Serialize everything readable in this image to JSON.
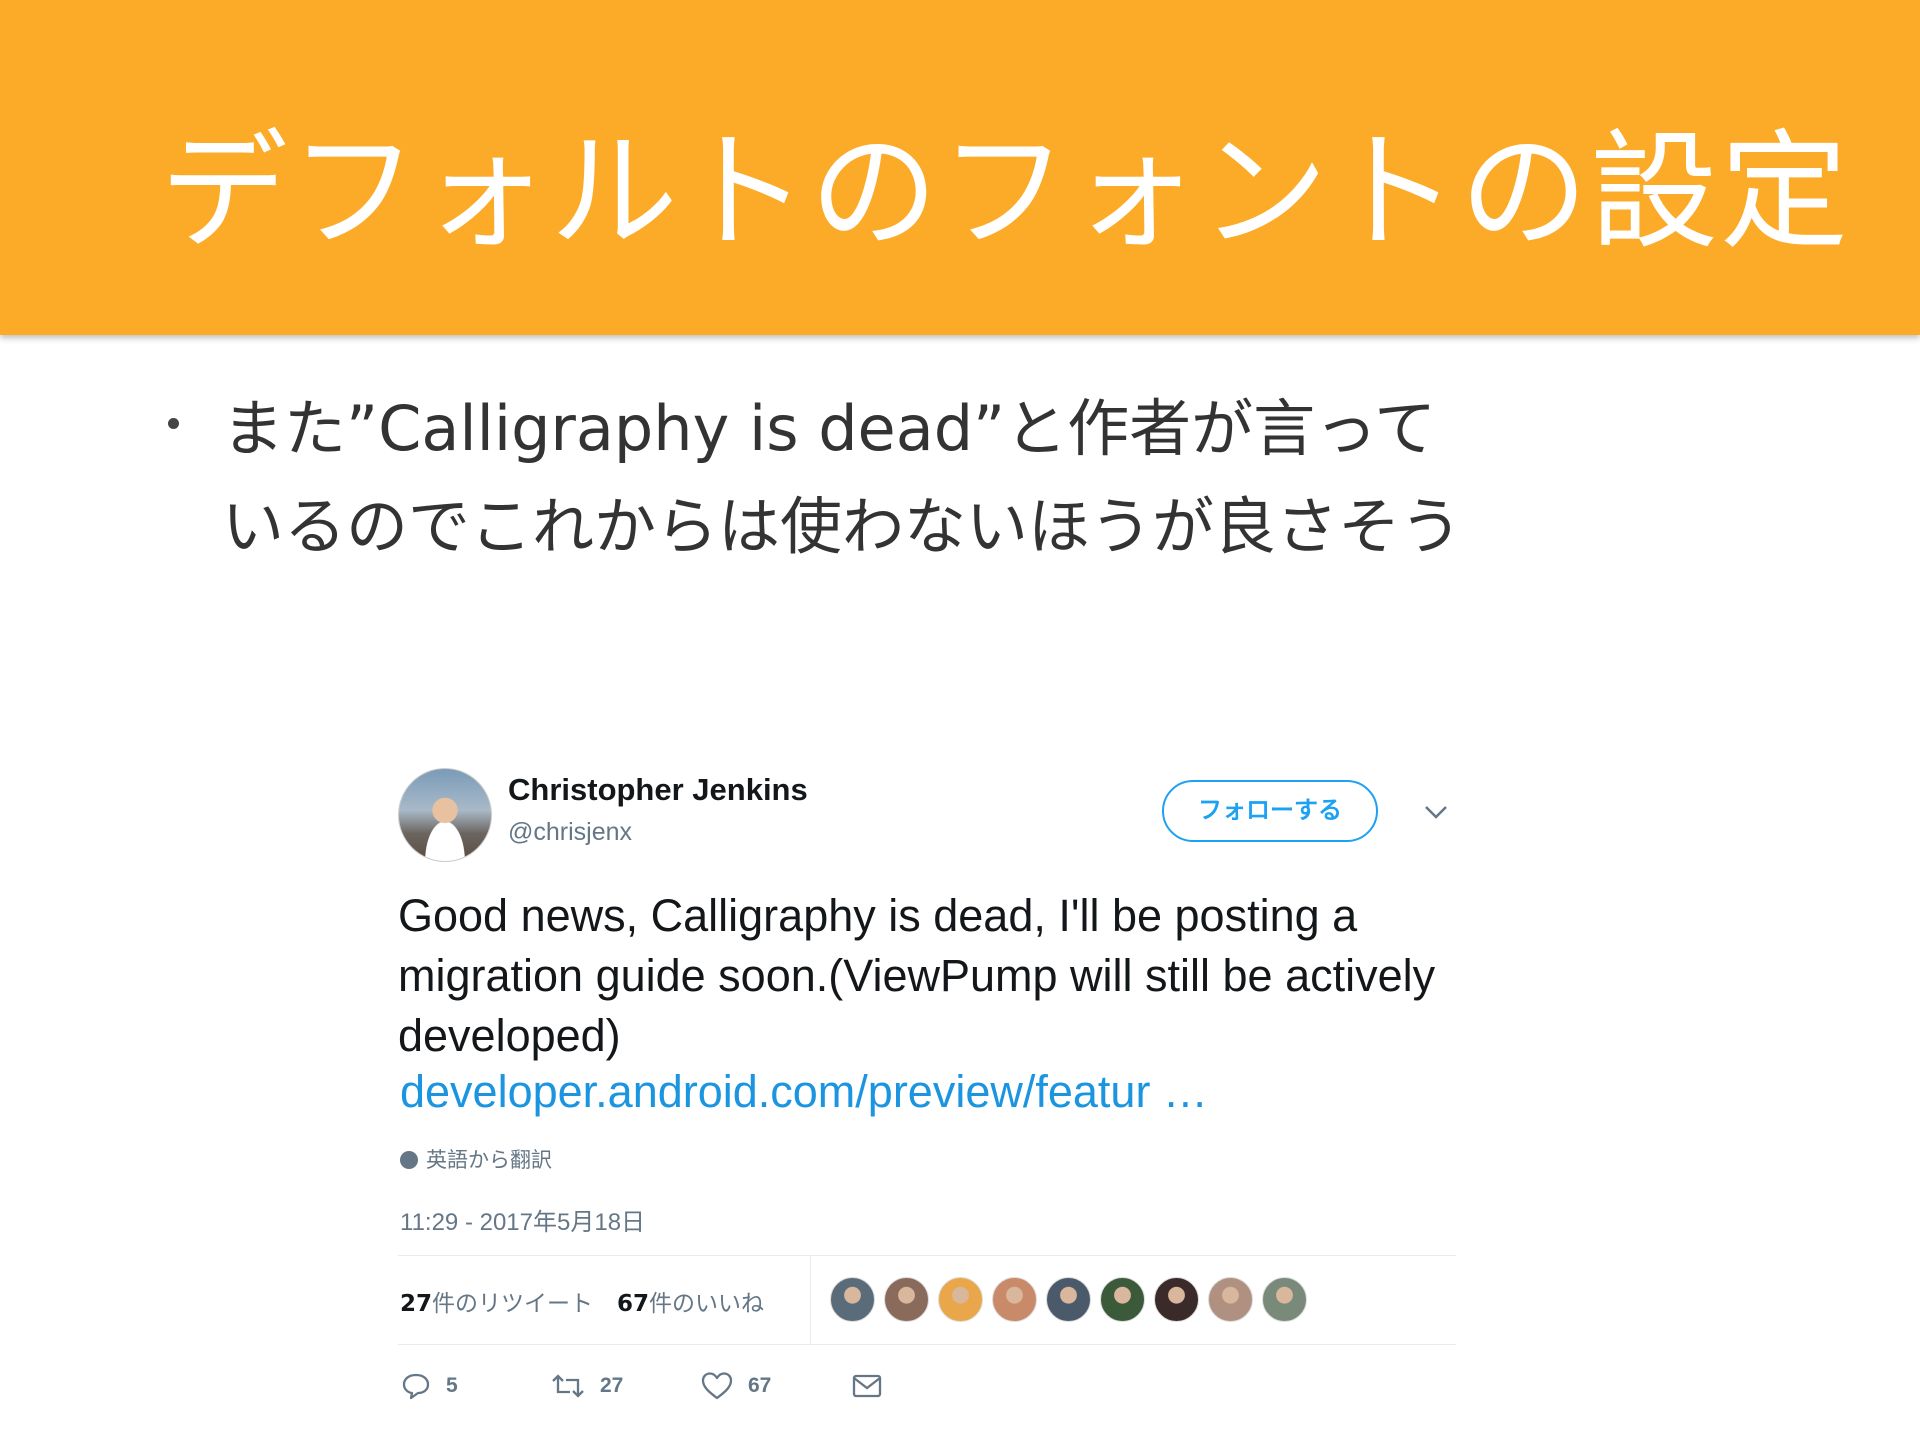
{
  "slide": {
    "title": "デフォルトのフォントの設定",
    "bullet_line1": "また”Calligraphy is dead”と作者が言って",
    "bullet_line2": "いるのでこれからは使わないほうが良さそう"
  },
  "tweet": {
    "author_name": "Christopher Jenkins",
    "author_handle": "@chrisjenx",
    "follow_label": "フォローする",
    "text": "Good news, Calligraphy is dead, I'll be posting a migration guide soon.(ViewPump will still be actively developed)",
    "link": "developer.android.com/preview/featur …",
    "translate_label": "英語から翻訳",
    "timestamp": "11:29 - 2017年5月18日",
    "retweet_count": "27",
    "retweet_label": "件のリツイート",
    "like_count": "67",
    "like_label": "件のいいね",
    "reply_action_count": "5",
    "retweet_action_count": "27",
    "like_action_count": "67",
    "liker_avatar_colors": [
      "#5a6c7a",
      "#8a6a5a",
      "#e9a64a",
      "#c98a6a",
      "#4a5a6a",
      "#3a5a3a",
      "#3a2a2a",
      "#b09080",
      "#7a8a7a"
    ],
    "accent_color": "#1da1f2"
  },
  "colors": {
    "header_bg": "#fcab28",
    "link": "#1b95e0"
  }
}
